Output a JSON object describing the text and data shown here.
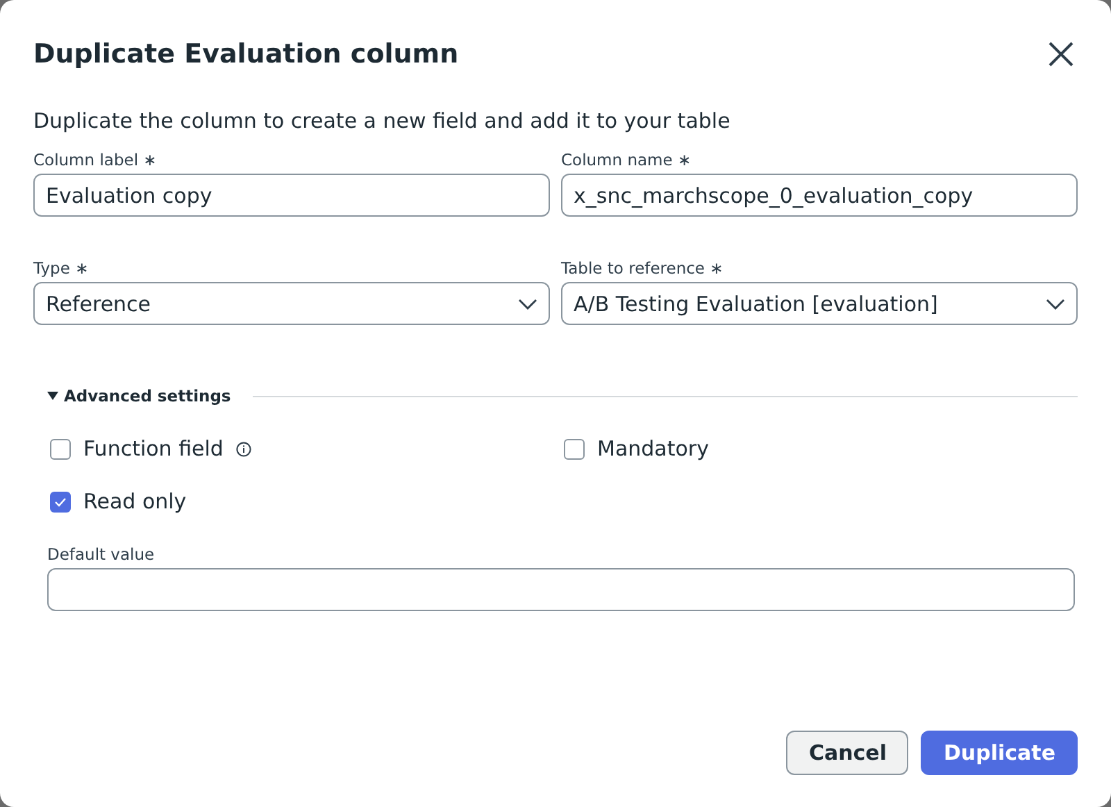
{
  "dialog": {
    "title": "Duplicate Evaluation column",
    "description": "Duplicate the column to create a new field and add it to your table"
  },
  "fields": [
    {
      "label": "Column label",
      "required_mark": "∗",
      "kind": "text",
      "value": "Evaluation copy"
    },
    {
      "label": "Column name",
      "required_mark": "∗",
      "kind": "text",
      "value": "x_snc_marchscope_0_evaluation_copy"
    },
    {
      "label": "Type",
      "required_mark": "∗",
      "kind": "select",
      "value": "Reference"
    },
    {
      "label": "Table to reference",
      "required_mark": "∗",
      "kind": "select",
      "value": "A/B Testing Evaluation [evaluation]"
    }
  ],
  "advanced": {
    "label": "Advanced settings",
    "expanded": true,
    "checkboxes": [
      {
        "label": "Function field",
        "checked": false,
        "info": true
      },
      {
        "label": "Mandatory",
        "checked": false,
        "info": false
      },
      {
        "label": "Read only",
        "checked": true,
        "info": false
      }
    ],
    "default_value": {
      "label": "Default value"
    }
  },
  "buttons": [
    {
      "label": "Cancel",
      "kind": "secondary"
    },
    {
      "label": "Duplicate",
      "kind": "primary"
    }
  ]
}
